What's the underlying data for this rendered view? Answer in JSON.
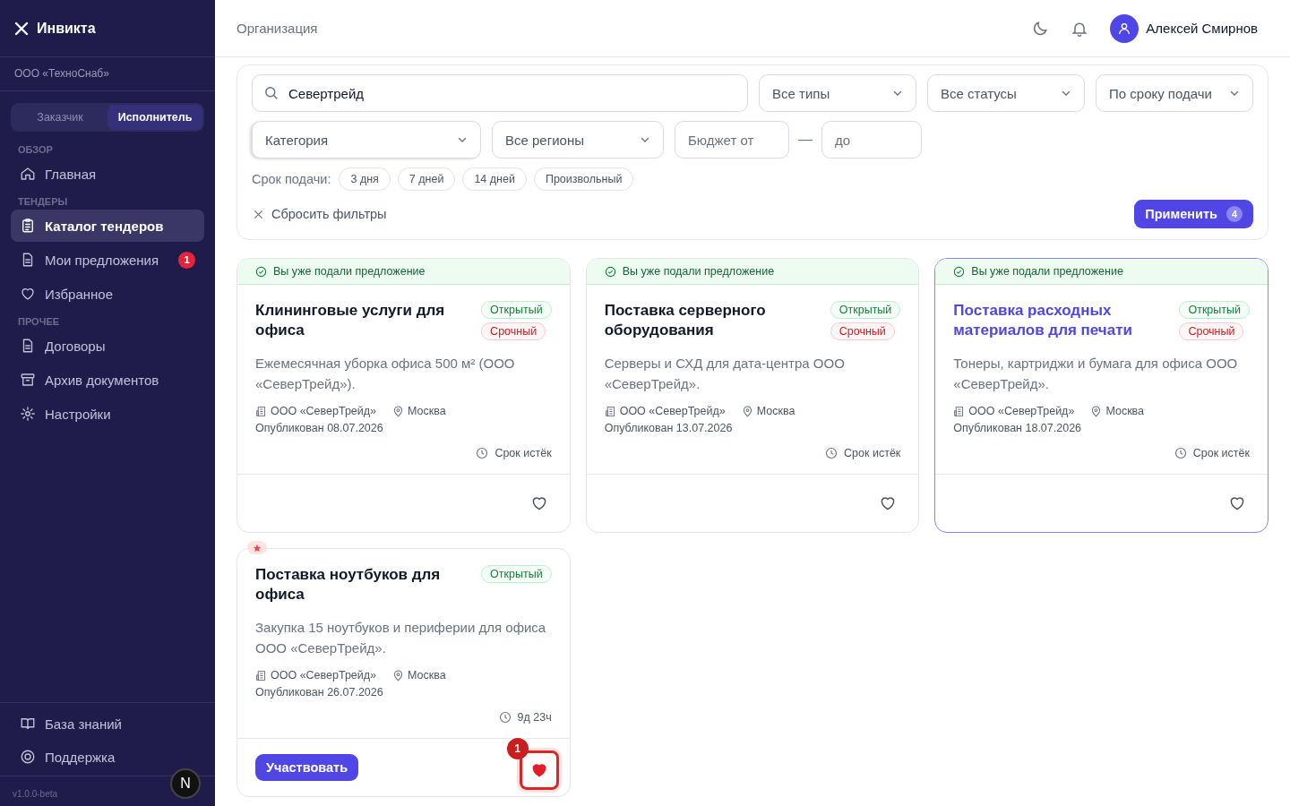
{
  "sidebar": {
    "logo": "Инвикта",
    "organization": "ООО «ТехноСнаб»",
    "roles": [
      {
        "label": "Заказчик",
        "selected": false
      },
      {
        "label": "Исполнитель",
        "selected": true
      }
    ],
    "sections": [
      {
        "title": "ОБЗОР",
        "items": [
          {
            "label": "Главная",
            "selected": false
          }
        ]
      },
      {
        "title": "ТЕНДЕРЫ",
        "items": [
          {
            "label": "Каталог тендеров",
            "selected": true
          },
          {
            "label": "Мои предложения",
            "selected": false,
            "badge": "1"
          },
          {
            "label": "Избранное",
            "selected": false
          }
        ]
      },
      {
        "title": "ПРОЧЕЕ",
        "items": [
          {
            "label": "Договоры",
            "selected": false
          },
          {
            "label": "Архив документов",
            "selected": false
          },
          {
            "label": "Настройки",
            "selected": false
          }
        ]
      }
    ],
    "bottom_items": [
      {
        "label": "База знаний"
      },
      {
        "label": "Поддержка"
      }
    ],
    "version": "v1.0.0-beta",
    "dev_indicator": "N"
  },
  "header": {
    "title": "Организация",
    "user_name": "Алексей Смирнов"
  },
  "filters": {
    "search": {
      "value": "Севертрейд"
    },
    "selects_row1": [
      "Все типы",
      "Все статусы",
      "По сроку подачи"
    ],
    "category": {
      "placeholder": "Категория"
    },
    "region": "Все регионы",
    "budget_from": {
      "placeholder": "Бюджет от"
    },
    "budget_separator": "—",
    "budget_to": {
      "placeholder": "до"
    },
    "deadline_label": "Срок подачи:",
    "deadline_chips": [
      {
        "label": "3 дня",
        "selected": false
      },
      {
        "label": "7 дней",
        "selected": false
      },
      {
        "label": "14 дней",
        "selected": false
      },
      {
        "label": "Произвольный",
        "selected": false
      }
    ],
    "reset": "Сбросить фильтры",
    "apply": {
      "label": "Применить",
      "count": "4"
    }
  },
  "tenders": [
    {
      "submitted_banner": "Вы уже подали предложение",
      "title": "Клининговые услуги для офиса",
      "highlighted": false,
      "tags": [
        {
          "label": "Открытый",
          "kind": "open"
        },
        {
          "label": "Срочный",
          "kind": "urgent"
        }
      ],
      "description": "Ежемесячная уборка офиса 500 м² (ООО «СеверТрейд»).",
      "organization": "ООО «СеверТрейд»",
      "city": "Москва",
      "published": "Опубликован 08.07.2026",
      "deadline": "Срок истёк",
      "featured": false,
      "favorite": false
    },
    {
      "submitted_banner": "Вы уже подали предложение",
      "title": "Поставка серверного оборудования",
      "highlighted": false,
      "tags": [
        {
          "label": "Открытый",
          "kind": "open"
        },
        {
          "label": "Срочный",
          "kind": "urgent"
        }
      ],
      "description": "Серверы и СХД для дата-центра ООО «СеверТрейд».",
      "organization": "ООО «СеверТрейд»",
      "city": "Москва",
      "published": "Опубликован 13.07.2026",
      "deadline": "Срок истёк",
      "featured": false,
      "favorite": false
    },
    {
      "submitted_banner": "Вы уже подали предложение",
      "title": "Поставка расходных материалов для печати",
      "highlighted": true,
      "tags": [
        {
          "label": "Открытый",
          "kind": "open"
        },
        {
          "label": "Срочный",
          "kind": "urgent"
        }
      ],
      "description": "Тонеры, картриджи и бумага для офиса ООО «СеверТрейд».",
      "organization": "ООО «СеверТрейд»",
      "city": "Москва",
      "published": "Опубликован 18.07.2026",
      "deadline": "Срок истёк",
      "featured": false,
      "favorite": false
    },
    {
      "title": "Поставка ноутбуков для офиса",
      "highlighted": false,
      "tags": [
        {
          "label": "Открытый",
          "kind": "open"
        }
      ],
      "description": "Закупка 15 ноутбуков и периферии для офиса ООО «СеверТрейд».",
      "organization": "ООО «СеверТрейд»",
      "city": "Москва",
      "published": "Опубликован 26.07.2026",
      "deadline": "9д 23ч",
      "featured": true,
      "participate": "Участвовать",
      "favorite": true,
      "favorite_count": "1"
    }
  ]
}
